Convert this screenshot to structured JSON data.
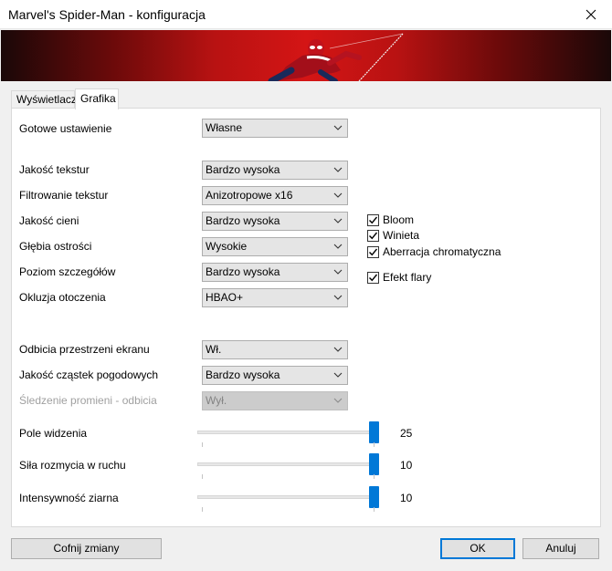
{
  "window": {
    "title": "Marvel's Spider-Man - konfiguracja"
  },
  "tabs": [
    {
      "label": "Wyświetlacz",
      "active": false
    },
    {
      "label": "Grafika",
      "active": true
    }
  ],
  "settings": {
    "preset": {
      "label": "Gotowe ustawienie",
      "value": "Własne"
    },
    "texture_quality": {
      "label": "Jakość tekstur",
      "value": "Bardzo wysoka"
    },
    "texture_filtering": {
      "label": "Filtrowanie tekstur",
      "value": "Anizotropowe x16"
    },
    "shadow_quality": {
      "label": "Jakość cieni",
      "value": "Bardzo wysoka"
    },
    "depth_of_field": {
      "label": "Głębia ostrości",
      "value": "Wysokie"
    },
    "level_of_detail": {
      "label": "Poziom szczegółów",
      "value": "Bardzo wysoka"
    },
    "ambient_occlusion": {
      "label": "Okluzja otoczenia",
      "value": "HBAO+"
    },
    "ssr": {
      "label": "Odbicia przestrzeni ekranu",
      "value": "Wł."
    },
    "weather_particles": {
      "label": "Jakość cząstek pogodowych",
      "value": "Bardzo wysoka"
    },
    "ray_tracing": {
      "label": "Śledzenie promieni - odbicia",
      "value": "Wył.",
      "disabled": true
    }
  },
  "checkboxes": {
    "bloom": {
      "label": "Bloom",
      "checked": true
    },
    "vignette": {
      "label": "Winieta",
      "checked": true
    },
    "chromatic": {
      "label": "Aberracja chromatyczna",
      "checked": true
    },
    "lens_flare": {
      "label": "Efekt flary",
      "checked": true
    }
  },
  "sliders": {
    "fov": {
      "label": "Pole widzenia",
      "value": "25"
    },
    "motion_blur": {
      "label": "Siła rozmycia w ruchu",
      "value": "10"
    },
    "film_grain": {
      "label": "Intensywność ziarna",
      "value": "10"
    }
  },
  "buttons": {
    "revert": "Cofnij zmiany",
    "ok": "OK",
    "cancel": "Anuluj"
  },
  "colors": {
    "accent": "#0078d7",
    "banner_red": "#d41515"
  }
}
